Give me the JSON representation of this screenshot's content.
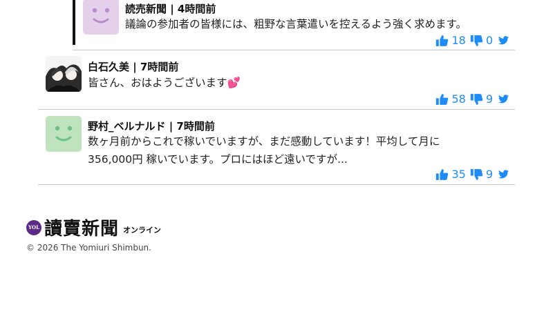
{
  "comments": [
    {
      "author": "読売新聞 | 4時間前",
      "avatar": "smiley-avatar-purple",
      "avatar_color": "#e5d0ec",
      "face_color": "#b98ccb",
      "lines": [
        "議論の参加者の皆様には、粗野な言葉遣いを控えるよう強く求めます。"
      ],
      "likes": "18",
      "dislikes": "0"
    },
    {
      "author": "白石久美 | 7時間前",
      "avatar": "illustrated-avatar",
      "lines": [
        "皆さん、おはようございます💕"
      ],
      "likes": "58",
      "dislikes": "9"
    },
    {
      "author": "野村_ベルナルド | 7時間前",
      "avatar": "smiley-avatar-green",
      "avatar_color": "#bfe3bd",
      "face_color": "#6cc08a",
      "lines": [
        "数ヶ月前からこれで稼いでいますが、まだ感動しています！平均して月に",
        "356,000円 稼いでいます。プロにはほど遠いですが..."
      ],
      "likes": "35",
      "dislikes": "9"
    }
  ],
  "icons": {
    "like": "thumbs-up-icon",
    "dislike": "thumbs-down-icon",
    "share": "twitter-bird-icon"
  },
  "colors": {
    "action_blue": "#1d8cf8",
    "logo_purple": "#5a2a86"
  },
  "footer": {
    "logo_badge": "YOL",
    "logo_text": "讀賣新聞",
    "logo_sub": "オンライン",
    "copyright": "© 2026 The Yomiuri Shimbun."
  }
}
